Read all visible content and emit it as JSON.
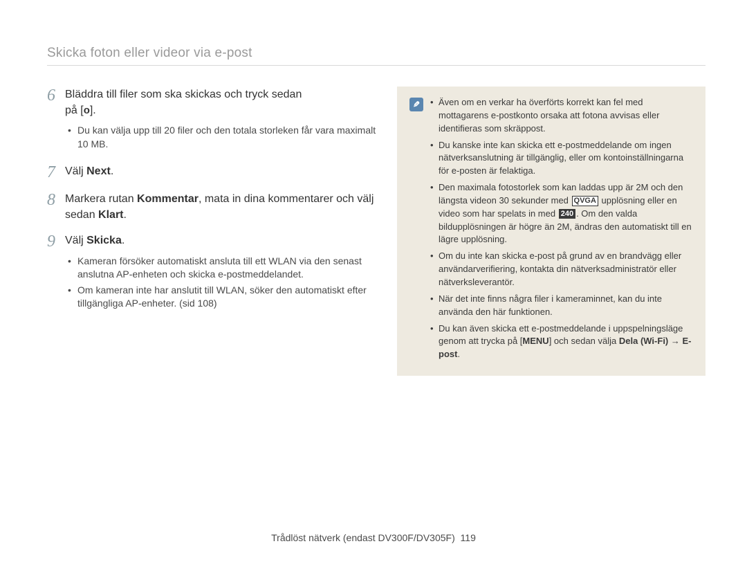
{
  "page_title": "Skicka foton eller videor via e-post",
  "steps": {
    "s6": {
      "num": "6",
      "line1": "Bläddra till filer som ska skickas och tryck sedan",
      "line2_prefix": "på [",
      "ok": "o",
      "line2_suffix": "].",
      "bullet1": "Du kan välja upp till 20 filer och den totala storleken får vara maximalt 10 MB."
    },
    "s7": {
      "num": "7",
      "prefix": "Välj ",
      "bold": "Next",
      "suffix": "."
    },
    "s8": {
      "num": "8",
      "p1": "Markera rutan ",
      "b1": "Kommentar",
      "p2": ", mata in dina kommentarer och välj sedan ",
      "b2": "Klart",
      "p3": "."
    },
    "s9": {
      "num": "9",
      "prefix": "Välj ",
      "bold": "Skicka",
      "suffix": ".",
      "bullet1": "Kameran försöker automatiskt ansluta till ett WLAN via den senast anslutna AP-enheten och skicka e-postmeddelandet.",
      "bullet2": "Om kameran inte har anslutit till WLAN, söker den automatiskt efter tillgängliga AP-enheter. (sid 108)"
    }
  },
  "notes": {
    "n1": "Även om en verkar ha överförts korrekt kan fel med mottagarens e-postkonto orsaka att fotona avvisas eller identifieras som skräppost.",
    "n2": "Du kanske inte kan skicka ett e-postmeddelande om ingen nätverksanslutning är tillgänglig, eller om kontoinställningarna för e-posten är felaktiga.",
    "n3a": "Den maximala fotostorlek som kan laddas upp är 2M och den längsta videon 30 sekunder med ",
    "qvga": "QVGA",
    "n3b": " upplösning eller en video som har spelats in med ",
    "r240": "240",
    "n3c": ". Om den valda bildupplösningen är högre än 2M, ändras den automatiskt till en lägre upplösning.",
    "n4": "Om du inte kan skicka e-post på grund av en brandvägg eller användarverifiering, kontakta din nätverksadministratör eller nätverksleverantör.",
    "n5": "När det inte finns några filer i kameraminnet, kan du inte använda den här funktionen.",
    "n6a": "Du kan även skicka ett e-postmeddelande i uppspelningsläge genom att trycka på [",
    "menu": "MENU",
    "n6b": "] och sedan välja ",
    "n6bold": "Dela (Wi-Fi) → E-post",
    "n6c": "."
  },
  "footer": {
    "text": "Trådlöst nätverk (endast DV300F/DV305F)",
    "page": "119"
  }
}
